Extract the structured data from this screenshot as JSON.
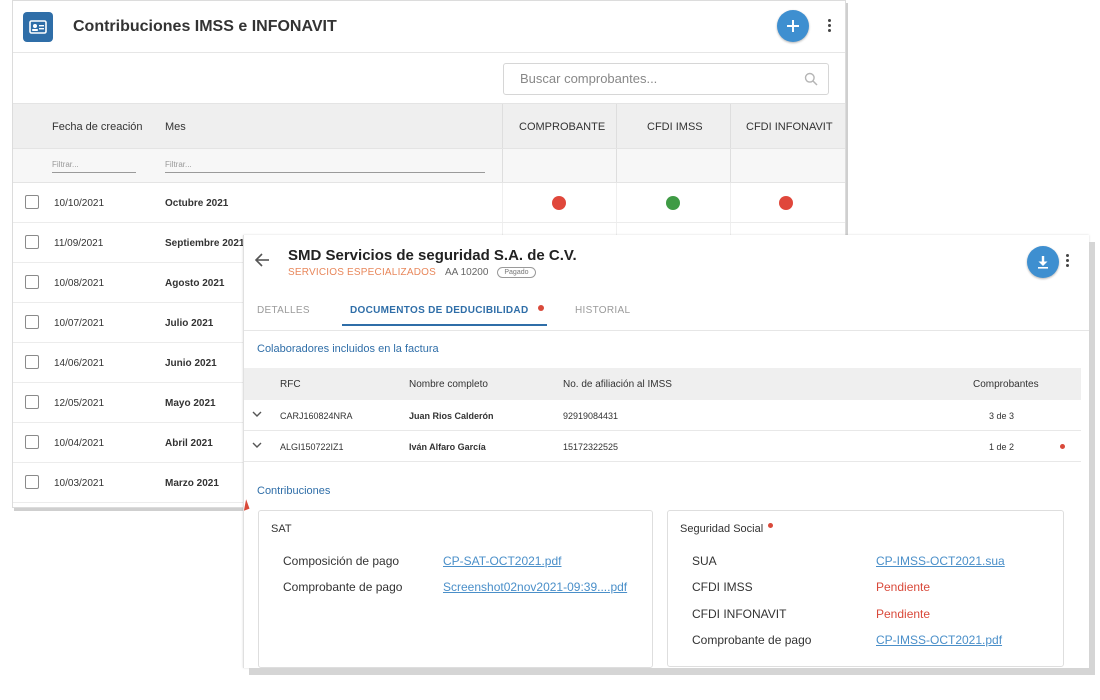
{
  "list_window": {
    "title": "Contribuciones IMSS e INFONAVIT",
    "icons": {
      "app": "id-card-icon",
      "add": "plus-icon",
      "menu": "more-vert-icon",
      "search": "search-icon"
    },
    "search_placeholder": "Buscar comprobantes...",
    "columns": {
      "fecha": "Fecha de creación",
      "mes": "Mes",
      "comprobante": "COMPROBANTE",
      "cfdi_imss": "CFDI IMSS",
      "cfdi_infonavit": "CFDI INFONAVIT"
    },
    "filter_placeholder": "Filtrar...",
    "rows": [
      {
        "fecha": "10/10/2021",
        "mes": "Octubre 2021",
        "comprobante": "red",
        "cfdi_imss": "green",
        "cfdi_infonavit": "red"
      },
      {
        "fecha": "11/09/2021",
        "mes": "Septiembre 2021"
      },
      {
        "fecha": "10/08/2021",
        "mes": "Agosto 2021"
      },
      {
        "fecha": "10/07/2021",
        "mes": "Julio 2021"
      },
      {
        "fecha": "14/06/2021",
        "mes": "Junio 2021"
      },
      {
        "fecha": "12/05/2021",
        "mes": "Mayo 2021"
      },
      {
        "fecha": "10/04/2021",
        "mes": "Abril 2021"
      },
      {
        "fecha": "10/03/2021",
        "mes": "Marzo 2021"
      }
    ]
  },
  "detail_window": {
    "title": "SMD Servicios de seguridad S.A. de C.V.",
    "category": "SERVICIOS ESPECIALIZADOS",
    "code": "AA 10200",
    "status_badge": "Pagado",
    "icons": {
      "back": "arrow-left-icon",
      "download": "download-icon",
      "menu": "more-vert-icon",
      "expand": "chevron-down-icon"
    },
    "tabs": [
      "DETALLES",
      "DOCUMENTOS DE DEDUCIBILIDAD",
      "HISTORIAL"
    ],
    "active_tab": "DOCUMENTOS DE DEDUCIBILIDAD",
    "collaborators_title": "Colaboradores incluidos en la factura",
    "collab_columns": {
      "rfc": "RFC",
      "nombre": "Nombre completo",
      "afiliacion": "No. de afiliación al IMSS",
      "comprobantes": "Comprobantes"
    },
    "collaborators": [
      {
        "rfc": "CARJ160824NRA",
        "nombre": "Juan Rios Calderón",
        "afiliacion": "92919084431",
        "comprobantes": "3 de 3"
      },
      {
        "rfc": "ALGI150722IZ1",
        "nombre": "Iván Alfaro García",
        "afiliacion": "15172322525",
        "comprobantes": "1 de 2"
      }
    ],
    "contributions_title": "Contribuciones",
    "sat": {
      "title": "SAT",
      "items": [
        {
          "label": "Composición de pago",
          "value": "CP-SAT-OCT2021.pdf"
        },
        {
          "label": "Comprobante de pago",
          "value": "Screenshot02nov2021-09:39....pdf"
        }
      ]
    },
    "social": {
      "title": "Seguridad Social",
      "items": [
        {
          "label": "SUA",
          "value": "CP-IMSS-OCT2021.sua"
        },
        {
          "label": "CFDI IMSS",
          "value": "Pendiente"
        },
        {
          "label": "CFDI INFONAVIT",
          "value": "Pendiente"
        },
        {
          "label": "Comprobante de pago",
          "value": "CP-IMSS-OCT2021.pdf"
        }
      ]
    }
  },
  "colors": {
    "primary": "#2f6ea8",
    "fab": "#3e8fd0",
    "status_red": "#e0473b",
    "status_green": "#3f9b45",
    "accent_orange": "#e8875b",
    "link": "#4a8fc9"
  }
}
